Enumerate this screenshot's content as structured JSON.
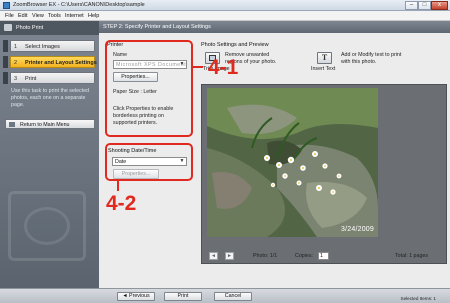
{
  "window": {
    "title": "ZoomBrowser EX  -  C:\\Users\\CANON\\Desktop\\sample",
    "controls": [
      "–",
      "□",
      "x"
    ]
  },
  "menu": [
    "File",
    "Edit",
    "View",
    "Tools",
    "Internet",
    "Help"
  ],
  "sidebar": {
    "header": "Photo Print",
    "steps": [
      {
        "num": "1",
        "label": "Select Images"
      },
      {
        "num": "2",
        "label": "Printer and Layout Settings"
      },
      {
        "num": "3",
        "label": "Print"
      }
    ],
    "help": "Use this task to print the selected photos, each one on a separate page.",
    "return_button": "Return to Main Menu"
  },
  "main": {
    "header": "STEP 2: Specify Printer and Layout Settings",
    "printer": {
      "group_label": "Printer",
      "name_label": "Name",
      "name_value": "Microsoft XPS Document",
      "properties_button": "Properties...",
      "paper_size": "Paper Size : Letter",
      "hint": "Click Properties to enable borderless printing on supported printers."
    },
    "shooting_date": {
      "group_label": "Shooting Date/Time",
      "selected": "Date",
      "properties_button": "Properties..."
    },
    "photo_settings": {
      "label": "Photo Settings and Preview",
      "trim_label": "Trim Image",
      "trim_desc": "Remove unwanted regions of your photo.",
      "text_label": "Insert Text",
      "text_desc": "Add or Modify text to print with this photo."
    },
    "preview": {
      "date_stamp": "3/24/2009",
      "photo_counter": "Photo: 1/1",
      "copies_label": "Copies:",
      "copies_value": "1",
      "total": "Total: 1 pages"
    }
  },
  "callouts": {
    "first": "4-1",
    "second": "4-2"
  },
  "footer": {
    "previous": "◄ Previous",
    "print": "Print",
    "cancel": "Cancel",
    "selected": "Selected Items: 1"
  }
}
